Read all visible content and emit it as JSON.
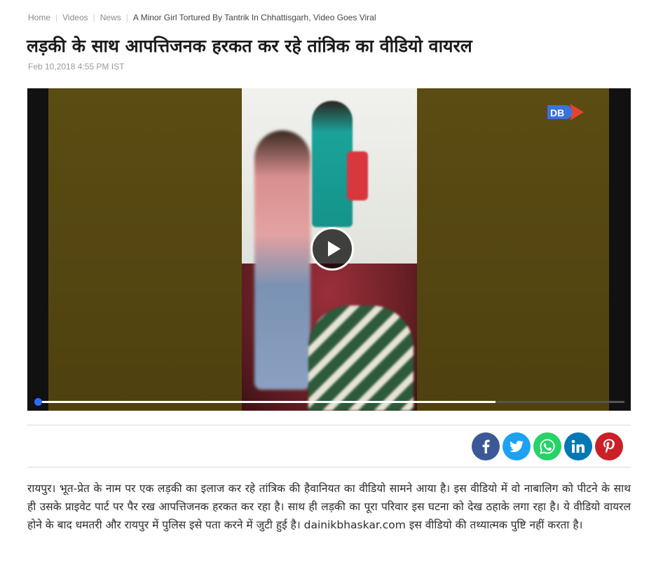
{
  "breadcrumb": {
    "items": [
      "Home",
      "Videos",
      "News"
    ],
    "current": "A Minor Girl Tortured By Tantrik In Chhattisgarh, Video Goes Viral"
  },
  "article": {
    "title": "लड़की के साथ आपत्तिजनक हरकत कर रहे तांत्रिक का वीडियो वायरल",
    "timestamp": "Feb 10,2018 4:55 PM IST",
    "body": "रायपुर। भूत-प्रेत के नाम पर एक लड़की का इलाज कर रहे तांत्रिक की हैवानियत का वीडियो सामने आया है। इस वीडियो में वो नाबालिग को पीटने के साथ ही उसके प्राइवेट पार्ट पर पैर रख आपत्तिजनक हरकत कर रहा है। साथ ही लड़की का पूरा परिवार इस घटना को देख ठहाके लगा रहा है। ये वीडियो वायरल होने के बाद धमतरी और रायपुर में पुलिस इसे पता करने में जुटी हुई है। dainikbhaskar.com इस वीडियो की तथ्यात्मक पुष्टि नहीं करता है।"
  },
  "video": {
    "brand_icon": "db-logo-icon",
    "play_icon": "play-icon",
    "progress_played_fraction": 0.78
  },
  "share": [
    {
      "icon": "facebook-icon",
      "color": "#3b5998"
    },
    {
      "icon": "twitter-icon",
      "color": "#1da1f2"
    },
    {
      "icon": "whatsapp-icon",
      "color": "#25d366"
    },
    {
      "icon": "linkedin-icon",
      "color": "#0077b5"
    },
    {
      "icon": "pinterest-icon",
      "color": "#cb2027"
    }
  ],
  "colors": {
    "title": "#1a1a1a",
    "meta": "#9a9a9a",
    "progress_handle": "#2e6bff"
  }
}
